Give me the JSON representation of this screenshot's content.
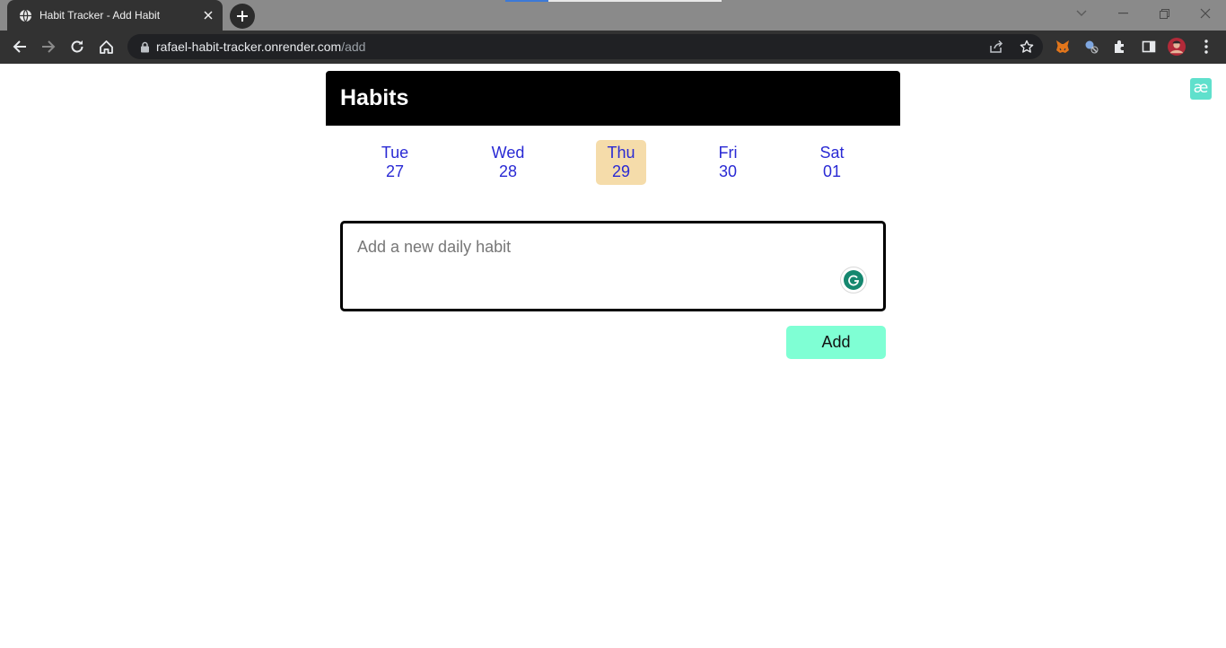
{
  "browser": {
    "tab_title": "Habit Tracker - Add Habit",
    "url_host": "rafael-habit-tracker.onrender.com",
    "url_path": "/add",
    "icons": [
      "globe-icon",
      "close-icon",
      "plus-icon",
      "back-icon",
      "forward-icon",
      "reload-icon",
      "home-icon",
      "lock-icon",
      "share-icon",
      "star-icon",
      "metamask-icon",
      "extension-icon",
      "puzzle-icon",
      "sidepanel-icon",
      "avatar",
      "menu-icon"
    ]
  },
  "page": {
    "title": "Habits",
    "days": [
      {
        "weekday": "Tue",
        "date": "27",
        "selected": false
      },
      {
        "weekday": "Wed",
        "date": "28",
        "selected": false
      },
      {
        "weekday": "Thu",
        "date": "29",
        "selected": true
      },
      {
        "weekday": "Fri",
        "date": "30",
        "selected": false
      },
      {
        "weekday": "Sat",
        "date": "01",
        "selected": false
      }
    ],
    "habit_input": {
      "value": "",
      "placeholder": "Add a new daily habit"
    },
    "add_button": "Add",
    "ae_badge": "æ"
  },
  "colors": {
    "header_bg": "#000000",
    "day_text": "#2a2ad4",
    "selected_day_bg": "#f5dcaa",
    "add_button_bg": "#7fffd4",
    "grammarly": "#15876f"
  }
}
